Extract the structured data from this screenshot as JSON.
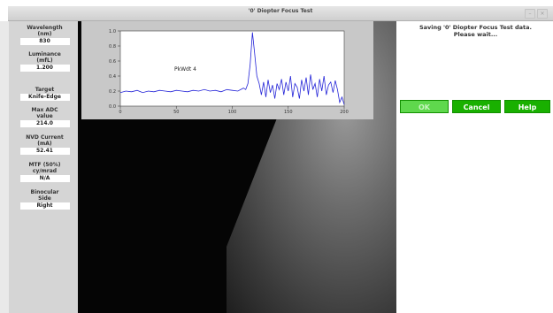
{
  "window": {
    "title": "'0' Diopter Focus Test",
    "controls": [
      "–",
      "×"
    ]
  },
  "params": [
    {
      "label_lines": [
        "Wavelength",
        "(nm)"
      ],
      "value": "830"
    },
    {
      "label_lines": [
        "Luminance",
        "(mfL)"
      ],
      "value": "1.200"
    },
    {
      "label_lines": [
        "Target"
      ],
      "value": "Knife-Edge"
    },
    {
      "label_lines": [
        "Max ADC",
        "value"
      ],
      "value": "214.0"
    },
    {
      "label_lines": [
        "NVD Current",
        "(mA)"
      ],
      "value": "52.41"
    },
    {
      "label_lines": [
        "MTF (50%)",
        "cy/mrad"
      ],
      "value": "N/A"
    },
    {
      "label_lines": [
        "Binocular",
        "Side"
      ],
      "value": "Right"
    }
  ],
  "status": {
    "lines": [
      "Saving '0' Diopter Focus Test data.",
      "Please wait..."
    ]
  },
  "buttons": {
    "ok": "OK",
    "cancel": "Cancel",
    "help": "Help"
  },
  "colors": {
    "button_green": "#19b000",
    "button_disabled": "#5fd84d",
    "plot_line": "#2424d8"
  },
  "chart_data": {
    "type": "line",
    "title": "",
    "xlabel": "",
    "ylabel": "",
    "xlim": [
      0,
      200
    ],
    "ylim": [
      0,
      1.0
    ],
    "xticks": [
      "0",
      "50",
      "100",
      "150",
      "200"
    ],
    "yticks": [
      "0.0",
      "0.2",
      "0.4",
      "0.6",
      "0.8",
      "1.0"
    ],
    "annotation": "PkWdt 4",
    "series": [
      {
        "x": [
          0,
          5,
          10,
          15,
          20,
          25,
          30,
          35,
          40,
          45,
          50,
          55,
          60,
          65,
          70,
          75,
          80,
          85,
          90,
          95,
          100,
          105,
          110,
          112,
          114,
          116,
          118,
          120,
          122,
          124,
          126,
          128,
          130,
          132,
          134,
          136,
          138,
          140,
          142,
          144,
          146,
          148,
          150,
          152,
          154,
          156,
          158,
          160,
          162,
          164,
          166,
          168,
          170,
          172,
          174,
          176,
          178,
          180,
          182,
          184,
          186,
          188,
          190,
          192,
          194,
          196,
          198,
          200
        ],
        "y": [
          0.18,
          0.2,
          0.19,
          0.21,
          0.18,
          0.2,
          0.19,
          0.21,
          0.2,
          0.19,
          0.21,
          0.2,
          0.19,
          0.21,
          0.2,
          0.22,
          0.2,
          0.21,
          0.19,
          0.22,
          0.21,
          0.2,
          0.24,
          0.22,
          0.3,
          0.55,
          0.98,
          0.7,
          0.4,
          0.3,
          0.15,
          0.32,
          0.12,
          0.35,
          0.18,
          0.28,
          0.1,
          0.3,
          0.22,
          0.36,
          0.15,
          0.32,
          0.2,
          0.4,
          0.12,
          0.3,
          0.25,
          0.1,
          0.35,
          0.2,
          0.38,
          0.15,
          0.42,
          0.22,
          0.3,
          0.12,
          0.36,
          0.2,
          0.4,
          0.15,
          0.28,
          0.32,
          0.18,
          0.34,
          0.22,
          0.05,
          0.12,
          0.02
        ]
      }
    ],
    "grid": false
  }
}
